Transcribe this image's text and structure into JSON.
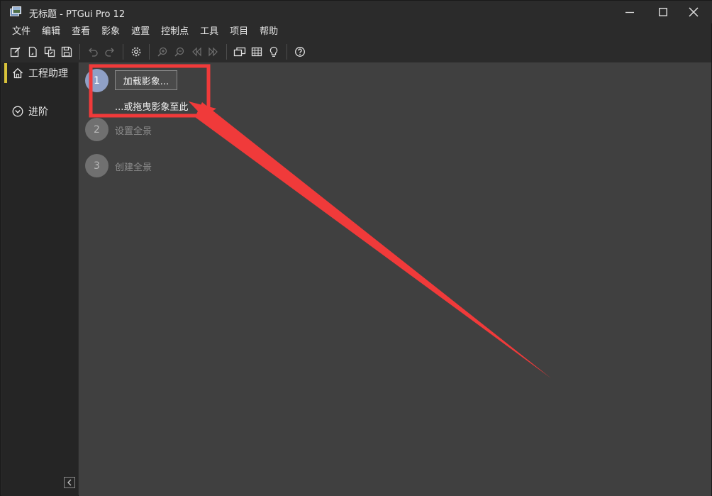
{
  "window": {
    "title": "无标题 - PTGui Pro 12"
  },
  "menu": [
    {
      "label": "文件"
    },
    {
      "label": "编辑"
    },
    {
      "label": "查看"
    },
    {
      "label": "影象"
    },
    {
      "label": "遮置"
    },
    {
      "label": "控制点"
    },
    {
      "label": "工具"
    },
    {
      "label": "项目"
    },
    {
      "label": "帮助"
    }
  ],
  "toolbar": {
    "icons": [
      "new-project-icon",
      "open-project-icon",
      "open-recent-icon",
      "save-icon",
      "undo-icon",
      "redo-icon",
      "settings-icon",
      "zoom-in-icon",
      "zoom-out-icon",
      "previous-icon",
      "next-icon",
      "panorama-editor-icon",
      "table-icon",
      "lightbulb-icon",
      "help-icon"
    ]
  },
  "sidebar": {
    "items": [
      {
        "label": "工程助理",
        "icon": "home-icon",
        "active": true
      },
      {
        "label": "进阶",
        "icon": "chevron-circle-down-icon",
        "active": false
      }
    ]
  },
  "steps": [
    {
      "number": "1",
      "button_label": "加载影象...",
      "hint": "...或拖曳影象至此",
      "active": true
    },
    {
      "number": "2",
      "label": "设置全景",
      "active": false
    },
    {
      "number": "3",
      "label": "创建全景",
      "active": false
    }
  ],
  "colors": {
    "sidebar_active_marker": "#d8c23a",
    "annotation_red": "#f03a3a",
    "main_bg": "#404040",
    "sidebar_bg": "#252525",
    "step_active": "#8fa0c6",
    "step_inactive": "#707070"
  }
}
